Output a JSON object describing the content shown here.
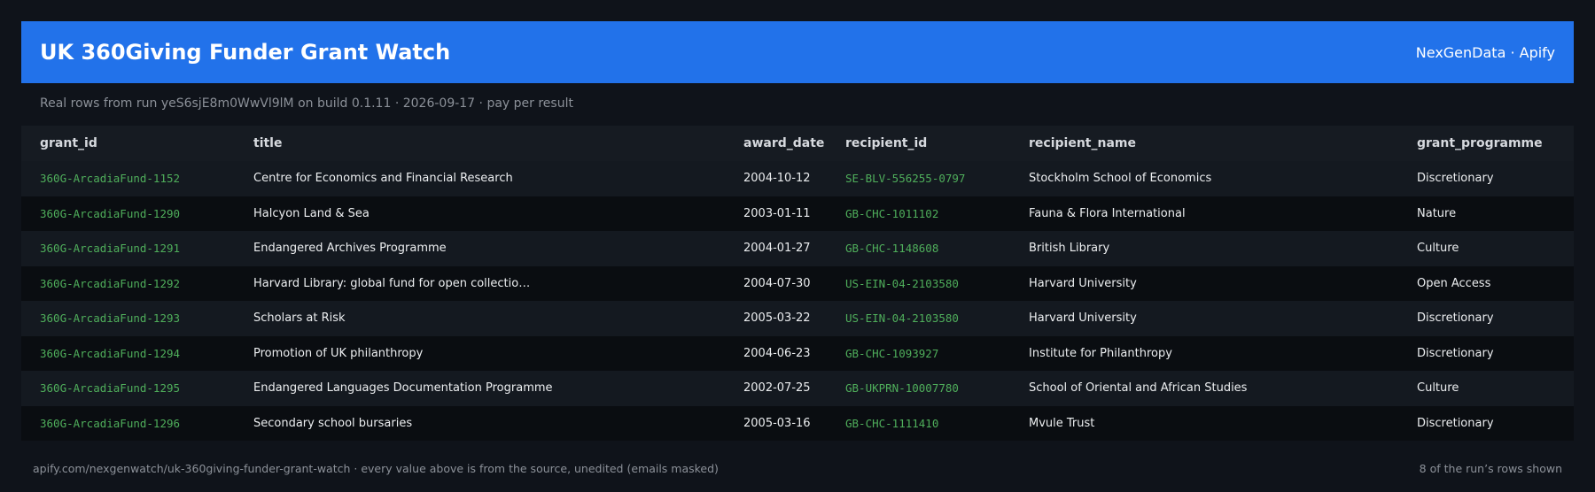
{
  "header": {
    "title": "UK 360Giving Funder Grant Watch",
    "brand": "NexGenData · Apify"
  },
  "subtitle": "Real rows from run yeS6sjE8m0WwVl9lM on build 0.1.11 · 2026-09-17 · pay per result",
  "colors": {
    "header_bg": "#2272ea",
    "id_text": "#4fae5b",
    "page_bg": "#0f131a"
  },
  "table": {
    "columns": [
      "grant_id",
      "title",
      "award_date",
      "recipient_id",
      "recipient_name",
      "grant_programme"
    ],
    "rows": [
      {
        "grant_id": "360G-ArcadiaFund-1152",
        "title": "Centre for Economics and Financial Research",
        "award_date": "2004-10-12",
        "recipient_id": "SE-BLV-556255-0797",
        "recipient_name": "Stockholm School of Economics",
        "grant_programme": "Discretionary"
      },
      {
        "grant_id": "360G-ArcadiaFund-1290",
        "title": "Halcyon Land & Sea",
        "award_date": "2003-01-11",
        "recipient_id": "GB-CHC-1011102",
        "recipient_name": "Fauna & Flora International",
        "grant_programme": "Nature"
      },
      {
        "grant_id": "360G-ArcadiaFund-1291",
        "title": "Endangered Archives Programme",
        "award_date": "2004-01-27",
        "recipient_id": "GB-CHC-1148608",
        "recipient_name": "British Library",
        "grant_programme": "Culture"
      },
      {
        "grant_id": "360G-ArcadiaFund-1292",
        "title": "Harvard Library: global fund for open collectio…",
        "award_date": "2004-07-30",
        "recipient_id": "US-EIN-04-2103580",
        "recipient_name": "Harvard University",
        "grant_programme": "Open Access"
      },
      {
        "grant_id": "360G-ArcadiaFund-1293",
        "title": "Scholars at Risk",
        "award_date": "2005-03-22",
        "recipient_id": "US-EIN-04-2103580",
        "recipient_name": "Harvard University",
        "grant_programme": "Discretionary"
      },
      {
        "grant_id": "360G-ArcadiaFund-1294",
        "title": "Promotion of UK philanthropy",
        "award_date": "2004-06-23",
        "recipient_id": "GB-CHC-1093927",
        "recipient_name": "Institute for Philanthropy",
        "grant_programme": "Discretionary"
      },
      {
        "grant_id": "360G-ArcadiaFund-1295",
        "title": "Endangered Languages Documentation Programme",
        "award_date": "2002-07-25",
        "recipient_id": "GB-UKPRN-10007780",
        "recipient_name": "School of Oriental and African Studies",
        "grant_programme": "Culture"
      },
      {
        "grant_id": "360G-ArcadiaFund-1296",
        "title": "Secondary school bursaries",
        "award_date": "2005-03-16",
        "recipient_id": "GB-CHC-1111410",
        "recipient_name": "Mvule Trust",
        "grant_programme": "Discretionary"
      }
    ]
  },
  "footer": {
    "left": "apify.com/nexgenwatch/uk-360giving-funder-grant-watch  ·  every value above is from the source, unedited (emails masked)",
    "right": "8 of the run’s rows shown"
  }
}
